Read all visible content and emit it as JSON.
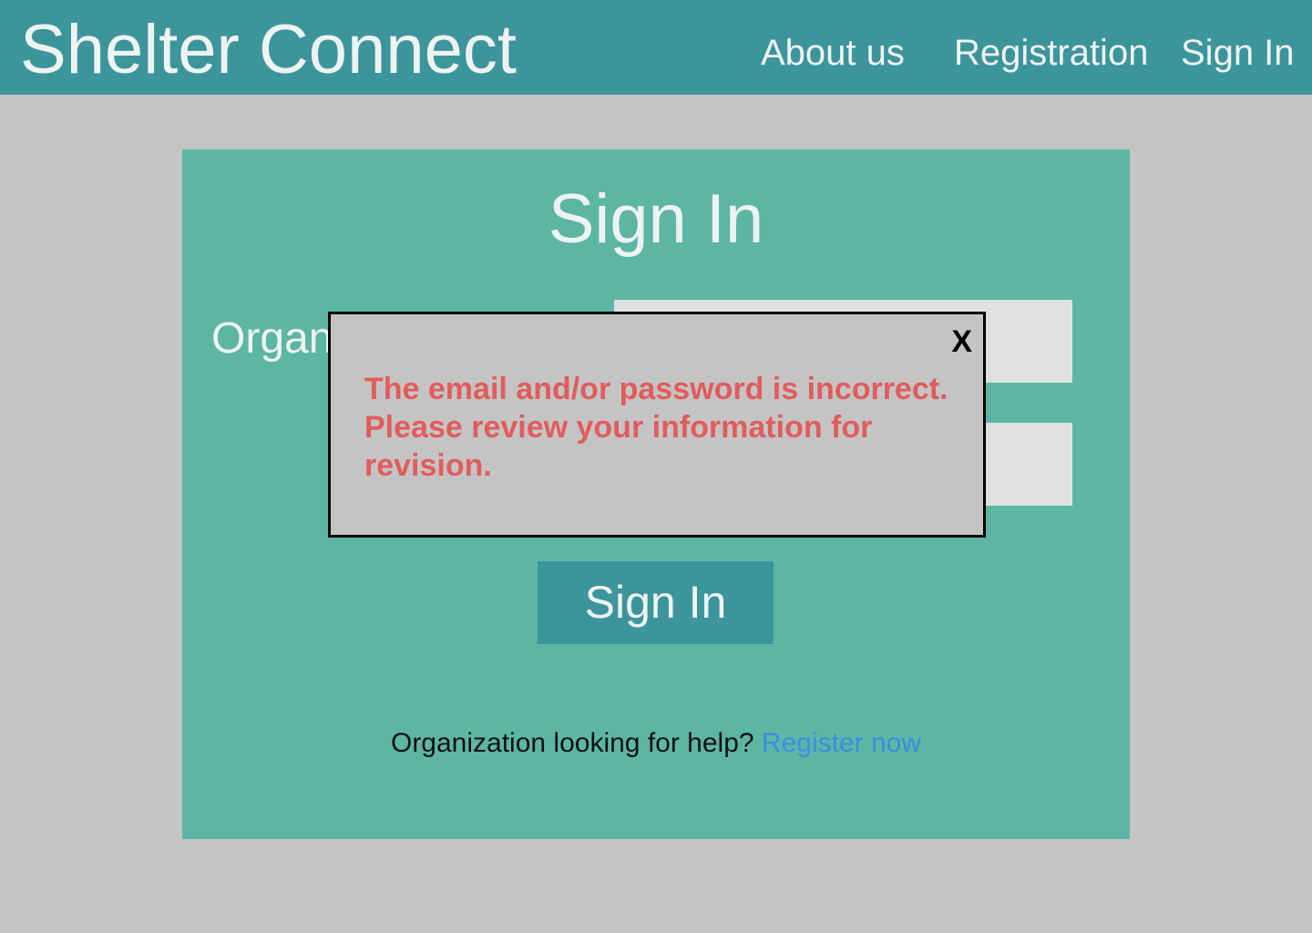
{
  "header": {
    "brand": "Shelter Connect",
    "nav": {
      "about": "About us",
      "registration": "Registration",
      "signin": "Sign In"
    }
  },
  "card": {
    "title": "Sign In",
    "org_label": "Organ",
    "signin_button": "Sign In",
    "help_text": "Organization looking for help?",
    "register_link": "Register now"
  },
  "modal": {
    "close": "X",
    "message": "The email and/or password is incorrect. Please review your information for revision."
  },
  "colors": {
    "header": "#3d959c",
    "card": "#5cb6a3",
    "background": "#c4c4c4",
    "error_text": "#e25c5c",
    "link": "#3b8de0"
  }
}
